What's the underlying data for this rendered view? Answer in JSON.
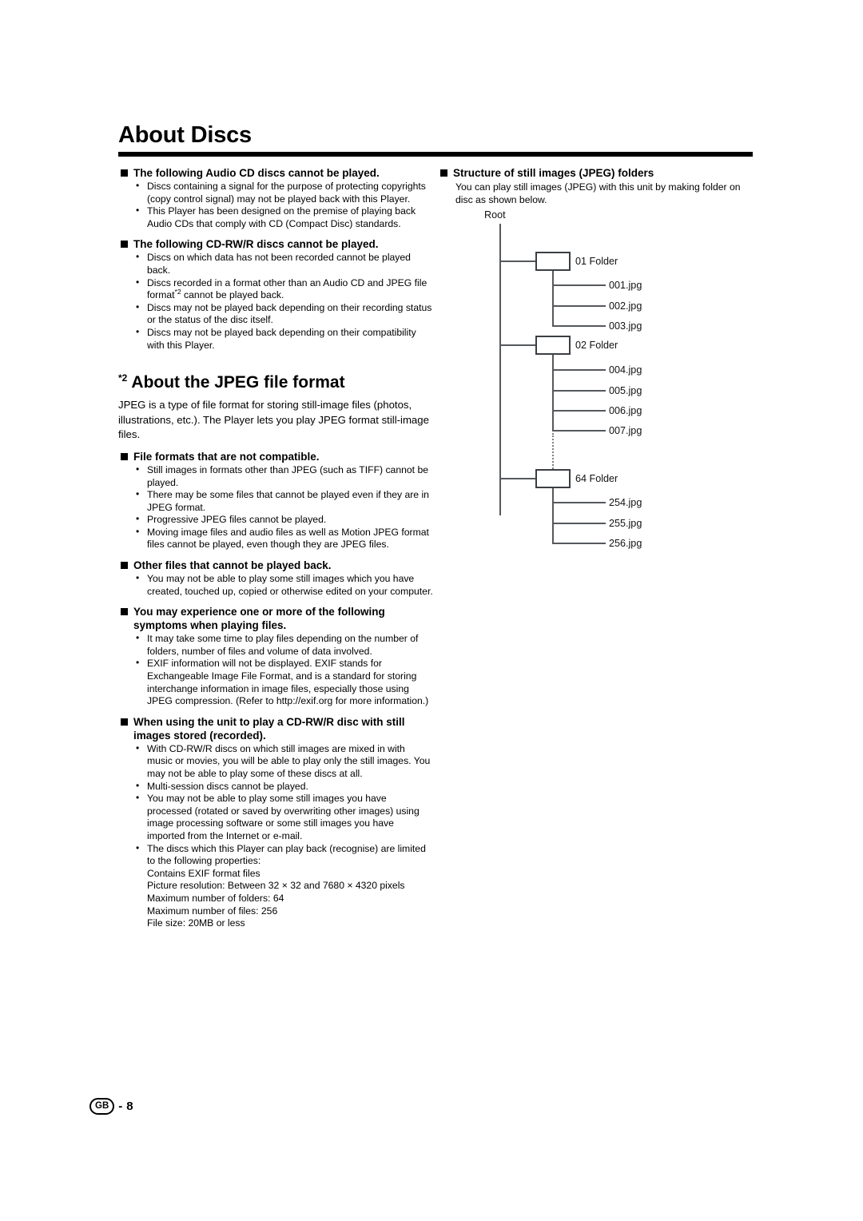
{
  "page": {
    "title": "About Discs",
    "footer": {
      "region_code": "GB",
      "separator": "-",
      "page_number": "8"
    }
  },
  "left_column": {
    "section_audio_cd": {
      "heading": "The following Audio CD discs cannot be played.",
      "bullets": [
        "Discs containing a signal for the purpose of protecting copyrights (copy control signal) may not be played back with this Player.",
        "This Player has been designed on the premise of playing back Audio CDs that comply with CD (Compact Disc) standards."
      ]
    },
    "section_cdrw": {
      "heading": "The following CD-RW/R discs cannot be played.",
      "bullets": [
        "Discs on which data has not been recorded cannot be played back.",
        "Discs recorded in a format other than an Audio CD and JPEG file format*2 cannot be played back.",
        "Discs may not be played back depending on their recording status or the status of the disc itself.",
        "Discs may not be played back depending on their compatibility with this Player."
      ],
      "bullet2_pre": "Discs recorded in a format other than an Audio CD and JPEG file format",
      "bullet2_star": "*2",
      "bullet2_post": " cannot be played back."
    },
    "section_jpeg": {
      "star": "*2",
      "heading": "About the JPEG file format",
      "intro": "JPEG is a type of file format for storing still-image files (photos, illustrations, etc.). The Player lets you play JPEG format still-image files."
    },
    "section_not_compatible": {
      "heading": "File formats that are not compatible.",
      "bullets": [
        "Still images in formats other than JPEG (such as TIFF) cannot be played.",
        "There may be some files that cannot be played even if they are in JPEG format.",
        "Progressive JPEG files cannot be played.",
        "Moving image files and audio files as well as Motion JPEG format files cannot be played, even though they are JPEG files."
      ]
    },
    "section_other_files": {
      "heading": "Other files that cannot be played back.",
      "bullets": [
        "You may not be able to play some still images which you have created, touched up, copied or otherwise edited on your computer."
      ]
    },
    "section_symptoms": {
      "heading": "You may experience one or more of the following symptoms when playing files.",
      "bullets": [
        "It may take some time to play files depending on the number of folders, number of files and volume of data involved.",
        "EXIF information will not be displayed. EXIF stands for Exchangeable Image File Format, and is a standard for storing interchange information in image files, especially those using JPEG compression. (Refer to http://exif.org for more information.)"
      ]
    },
    "section_cdrw_still": {
      "heading": "When using the unit to play a CD-RW/R disc with still images stored (recorded).",
      "bullets": [
        "With CD-RW/R discs on which still images are mixed in with music or movies, you will be able to play only the still images. You may not be able to play some of these discs at all.",
        "Multi-session discs cannot be played.",
        "You may not be able to play some still images you have processed (rotated or saved by overwriting other images) using image processing software or some still images you have imported from the Internet or e-mail.",
        "The discs which this Player can play back (recognise) are limited to the following properties:"
      ],
      "properties": [
        "Contains EXIF format files",
        "Picture resolution: Between 32 × 32 and 7680 × 4320 pixels",
        "Maximum number of folders: 64",
        "Maximum number of files: 256",
        "File size: 20MB or less"
      ]
    }
  },
  "right_column": {
    "section_structure": {
      "heading": "Structure of still images (JPEG) folders",
      "intro": "You can play still images (JPEG) with this unit by making folder on disc as shown below."
    },
    "tree": {
      "root_label": "Root",
      "folders": [
        {
          "label": "01 Folder",
          "files": [
            "001.jpg",
            "002.jpg",
            "003.jpg"
          ]
        },
        {
          "label": "02 Folder",
          "files": [
            "004.jpg",
            "005.jpg",
            "006.jpg",
            "007.jpg"
          ]
        },
        {
          "label": "64 Folder",
          "files": [
            "254.jpg",
            "255.jpg",
            "256.jpg"
          ]
        }
      ],
      "ellipsis_between": "dotted-vertical-line"
    }
  },
  "colors": {
    "text": "#000000",
    "rule": "#000000",
    "diagram_line": "#55585c",
    "diagram_box_border": "#3b3f43"
  }
}
